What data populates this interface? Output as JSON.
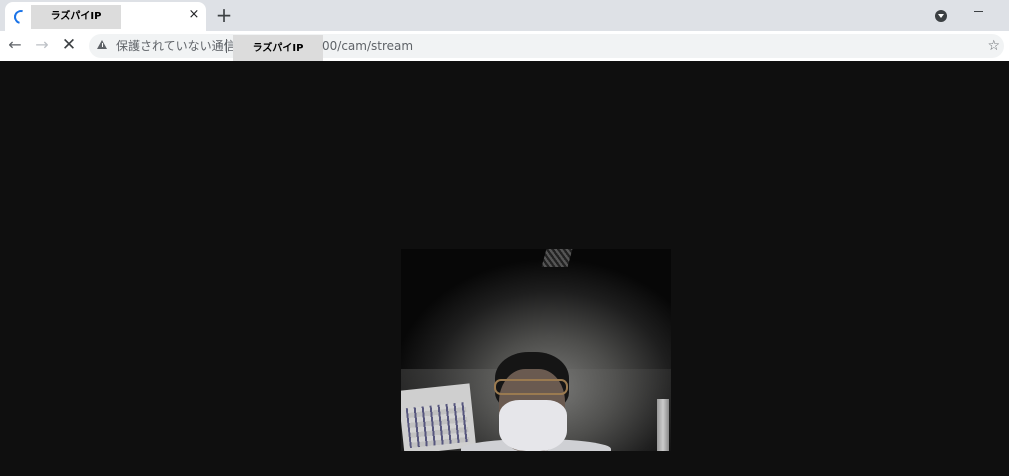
{
  "browser": {
    "tab": {
      "title": "ラズパイIP",
      "close_glyph": "×"
    },
    "new_tab_glyph": "+",
    "toolbar": {
      "back_glyph": "←",
      "forward_glyph": "→",
      "stop_glyph": "✕"
    },
    "omnibox": {
      "security_label": "保護されていない通信",
      "host_redacted": "ラズパイIP",
      "path": "00/cam/stream",
      "bookmark_glyph": "☆"
    }
  },
  "colors": {
    "page_background": "#0f0f0f",
    "tab_strip": "#dee1e6",
    "loading_spinner": "#1a73e8"
  },
  "icons": [
    "loading-spinner-icon",
    "close-icon",
    "plus-icon",
    "profile-menu-icon",
    "minimize-icon",
    "back-arrow-icon",
    "forward-arrow-icon",
    "stop-icon",
    "warning-icon",
    "star-icon"
  ]
}
